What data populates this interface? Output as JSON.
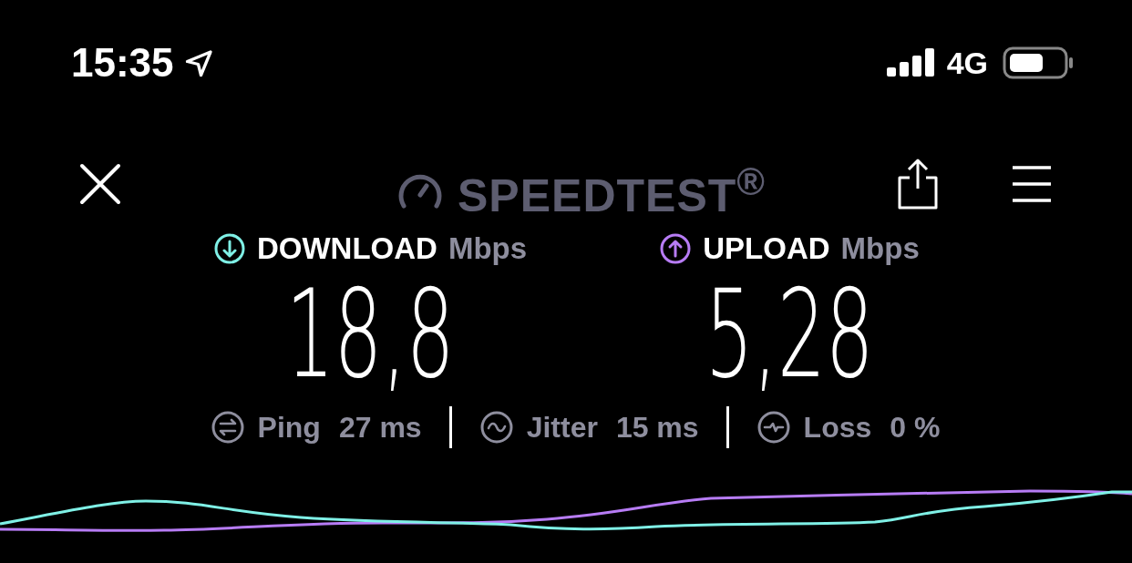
{
  "status_bar": {
    "time": "15:35",
    "network": "4G"
  },
  "header": {
    "logo": "SPEEDTEST$^{®}$"
  },
  "results": [
    {
      "kind": "download",
      "label": "DOWNLOAD",
      "unit": "Mbps",
      "value": "18,8"
    },
    {
      "kind": "upload",
      "label": "UPLOAD",
      "unit": "Mbps",
      "value": "5,28"
    }
  ],
  "metrics": [
    {
      "kind": "ping",
      "label": "Ping",
      "value": "27 ms"
    },
    {
      "kind": "jitter",
      "label": "Jitter",
      "value": "15 ms"
    },
    {
      "kind": "loss",
      "label": "Loss",
      "value": "0 %"
    }
  ]
}
